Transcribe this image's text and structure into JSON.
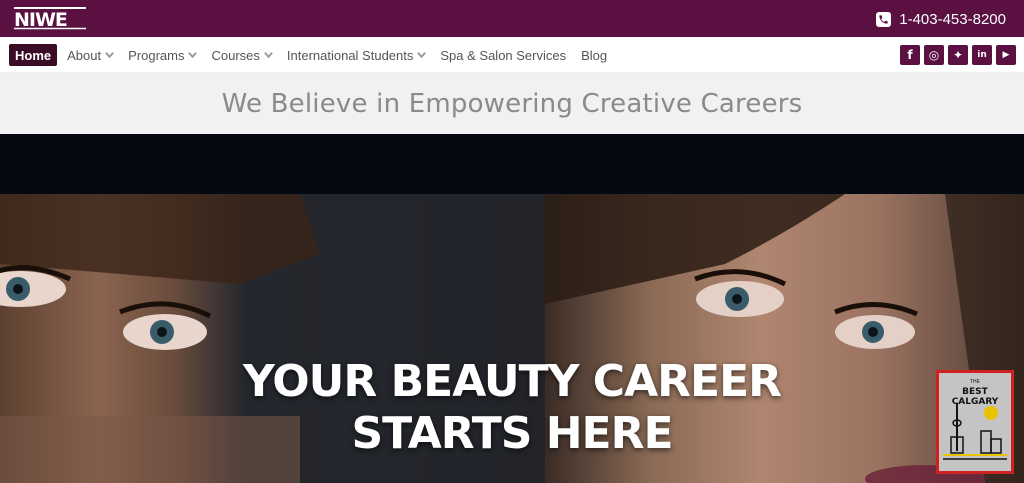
{
  "header": {
    "logo_text": "NIWE",
    "phone": "1-403-453-8200"
  },
  "nav": {
    "items": [
      {
        "label": "Home",
        "active": true,
        "dropdown": false
      },
      {
        "label": "About",
        "active": false,
        "dropdown": true
      },
      {
        "label": "Programs",
        "active": false,
        "dropdown": true
      },
      {
        "label": "Courses",
        "active": false,
        "dropdown": true
      },
      {
        "label": "International Students",
        "active": false,
        "dropdown": true
      },
      {
        "label": "Spa & Salon Services",
        "active": false,
        "dropdown": false
      },
      {
        "label": "Blog",
        "active": false,
        "dropdown": false
      }
    ],
    "social": [
      "facebook-icon",
      "instagram-icon",
      "twitter-icon",
      "linkedin-icon",
      "youtube-icon"
    ]
  },
  "tagline": "We Believe in Empowering Creative Careers",
  "hero": {
    "line1": "YOUR BEAUTY CAREER",
    "line2": "STARTS HERE"
  },
  "badge": {
    "the": "THE",
    "label": "BEST CALGARY"
  },
  "colors": {
    "brand": "#5a1040",
    "active_nav": "#3a0c26",
    "tagline_bg": "#f1f1f1",
    "hero_bg": "#050a12",
    "badge_border": "#d02020"
  }
}
